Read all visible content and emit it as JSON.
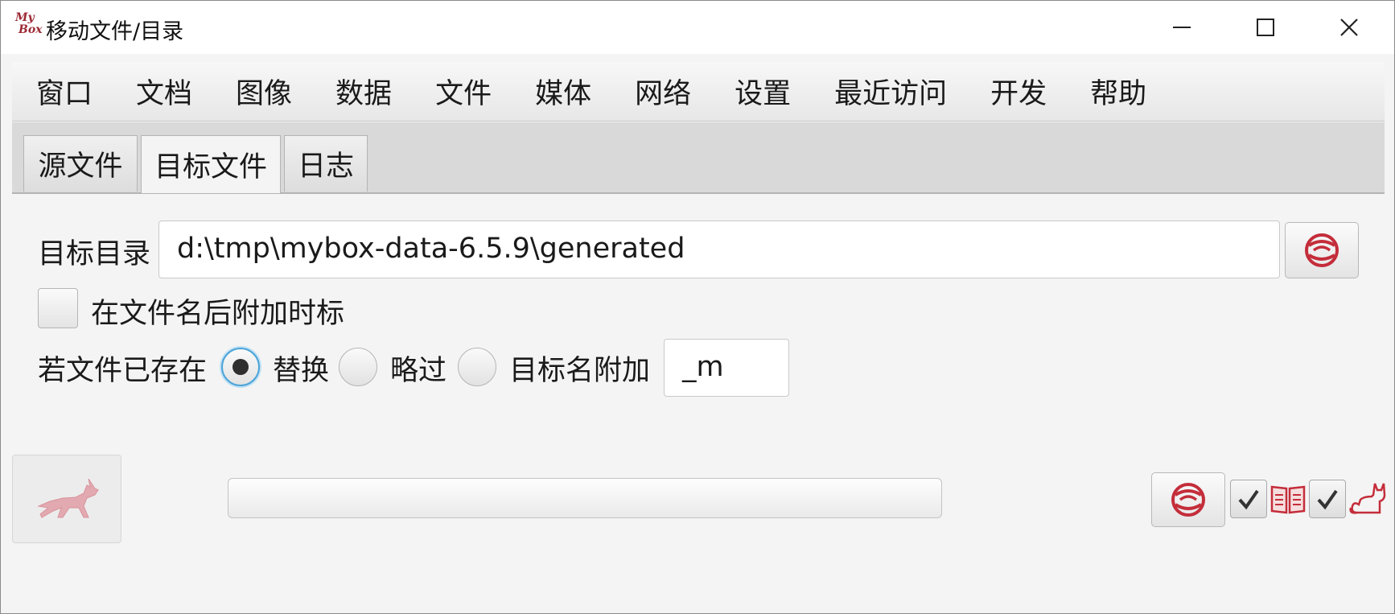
{
  "window": {
    "logo_line1": "My",
    "logo_line2": "Box",
    "title": "移动文件/目录"
  },
  "menubar": {
    "items": [
      "窗口",
      "文档",
      "图像",
      "数据",
      "文件",
      "媒体",
      "网络",
      "设置",
      "最近访问",
      "开发",
      "帮助"
    ]
  },
  "tabs": [
    {
      "label": "源文件",
      "active": false
    },
    {
      "label": "目标文件",
      "active": true
    },
    {
      "label": "日志",
      "active": false
    }
  ],
  "target": {
    "dir_label": "目标目录",
    "dir_value": "d:\\tmp\\mybox-data-6.5.9\\generated",
    "append_timestamp_label": "在文件名后附加时标",
    "append_timestamp_checked": false,
    "if_exists_label": "若文件已存在",
    "options": [
      {
        "label": "替换",
        "selected": true
      },
      {
        "label": "略过",
        "selected": false
      },
      {
        "label": "目标名附加",
        "selected": false
      }
    ],
    "suffix_value": "_m"
  },
  "footer": {
    "progress": 0,
    "check1_checked": true,
    "check2_checked": true
  },
  "colors": {
    "accent": "#c42d3a",
    "focus": "#4aa3d8"
  },
  "icons": {
    "browse": "folder-swirl-icon",
    "run": "antelope-icon",
    "open": "open-swirl-icon",
    "book": "book-icon",
    "cat": "cat-icon"
  }
}
